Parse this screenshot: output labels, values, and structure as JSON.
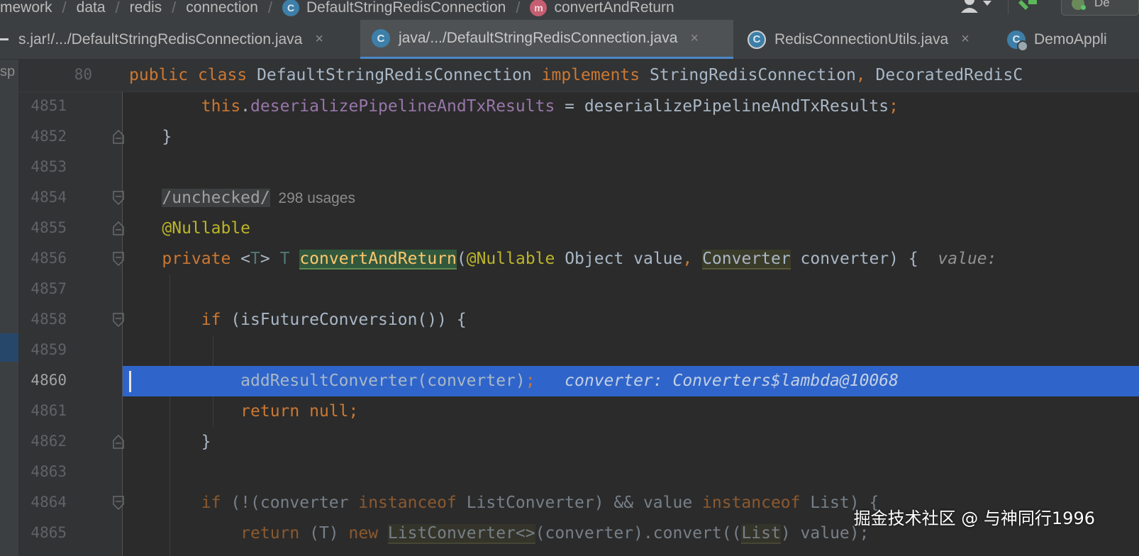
{
  "breadcrumb": {
    "items": [
      "mework",
      "data",
      "redis",
      "connection"
    ],
    "class_item": "DefaultStringRedisConnection",
    "class_icon_letter": "C",
    "method_item": "convertAndReturn",
    "method_icon_letter": "m",
    "run_config_label": "De"
  },
  "tabs": [
    {
      "label": "s.jar!/.../DefaultStringRedisConnection.java",
      "close": "×",
      "active": false
    },
    {
      "label": "java/.../DefaultStringRedisConnection.java",
      "icon_letter": "C",
      "close": "×",
      "active": true
    },
    {
      "label": "RedisConnectionUtils.java",
      "icon_letter": "C",
      "close": "×",
      "active": false
    },
    {
      "label": "DemoAppli",
      "icon_letter": "C",
      "active": false
    }
  ],
  "left_strip": {
    "label": "sp"
  },
  "sticky_header": {
    "line_number": "80",
    "kw_public": "public",
    "kw_class": "class",
    "class_name": "DefaultStringRedisConnection",
    "kw_implements": "implements",
    "iface1": "StringRedisConnection",
    "comma": ",",
    "iface2": "DecoratedRedisC"
  },
  "code": {
    "line_numbers": [
      "4851",
      "4852",
      "4853",
      "4854",
      "4855",
      "4856",
      "4857",
      "4858",
      "4859",
      "4860",
      "4861",
      "4862",
      "4863",
      "4864",
      "4865"
    ],
    "current_line": "4860",
    "l4851": {
      "indent": "        ",
      "this": "this",
      "dot": ".",
      "field": "deserializePipelineAndTxResults",
      "rest": " = deserializePipelineAndTxResults",
      "semi": ";"
    },
    "l4852": {
      "text": "    }"
    },
    "l4854": {
      "indent": "    ",
      "suppress": "/unchecked/",
      "usages": "298 usages"
    },
    "l4855": {
      "indent": "    ",
      "annotation": "@Nullable"
    },
    "l4856": {
      "indent": "    ",
      "kw_private": "private",
      "gen_open": " <",
      "tparam": "T",
      "gen_close": "> ",
      "ret_type": "T",
      "sp": " ",
      "method": "convertAndReturn",
      "paren": "(",
      "annotation": "@Nullable",
      "param1": " Object value",
      "comma": ", ",
      "conv_type": "Converter",
      "param2": " converter) {",
      "hint": "  value: "
    },
    "l4858": {
      "indent": "        ",
      "kw_if": "if",
      "rest": " (isFutureConversion()) {"
    },
    "l4860": {
      "indent": "            ",
      "call": "addResultConverter(converter)",
      "semi": ";",
      "hint": "   converter: Converters$lambda@10068"
    },
    "l4861": {
      "indent": "            ",
      "kw_return": "return",
      "sp": " ",
      "kw_null": "null",
      "semi": ";"
    },
    "l4862": {
      "text": "        }"
    },
    "l4864": {
      "indent": "        ",
      "kw_if": "if",
      "p1": " (!(converter ",
      "kw_instanceof": "instanceof",
      "p2": " ListConverter) && value ",
      "kw_instanceof2": "instanceof",
      "p3": " List) {"
    },
    "l4865": {
      "indent": "            ",
      "kw_return": "return",
      "p1": " (T) ",
      "kw_new": "new",
      "sp": " ",
      "type_hl": "ListConverter<>",
      "p2": "(converter).convert((",
      "list_hl": "List",
      "p3": ") value);"
    }
  },
  "watermark": {
    "text": "掘金技术社区 @ 与神同行1996"
  },
  "colors": {
    "editor_bg": "#2b2b2b",
    "gutter_bg": "#313335",
    "keyword": "#cc7832",
    "field": "#9876aa",
    "annotation": "#bbb529",
    "method_decl": "#ffc66d",
    "current_line_bg": "#2f65ca",
    "tab_underline": "#4a88c7"
  },
  "icons": [
    "class-icon",
    "method-icon",
    "user-icon",
    "hammer-icon",
    "run-config-icon",
    "fold-icon",
    "close-icon"
  ]
}
